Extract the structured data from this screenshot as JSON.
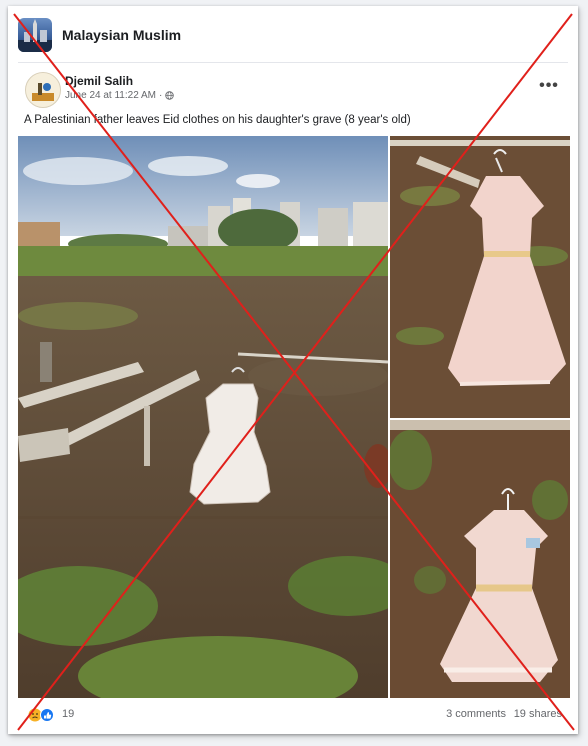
{
  "group": {
    "name": "Malaysian Muslim"
  },
  "post": {
    "author": "Djemil Salih",
    "timestamp": "June 24 at 11:22 AM",
    "separator": "·",
    "privacy_icon": "globe-icon",
    "more_label": "•••",
    "caption": "A Palestinian father leaves Eid clothes on his daughter's grave (8 year's old)"
  },
  "photos": [
    {
      "id": "main",
      "subject": "white dress at grave"
    },
    {
      "id": "top-right",
      "subject": "pink dress on hanger"
    },
    {
      "id": "bottom-right",
      "subject": "pink dress on hanger close-up"
    }
  ],
  "footer": {
    "reaction_icons": [
      "sad-reaction-icon",
      "like-reaction-icon"
    ],
    "reaction_count": "19",
    "comments": "3 comments",
    "shares": "19 shares"
  },
  "overlay": {
    "color": "#e0201b",
    "type": "cross"
  }
}
